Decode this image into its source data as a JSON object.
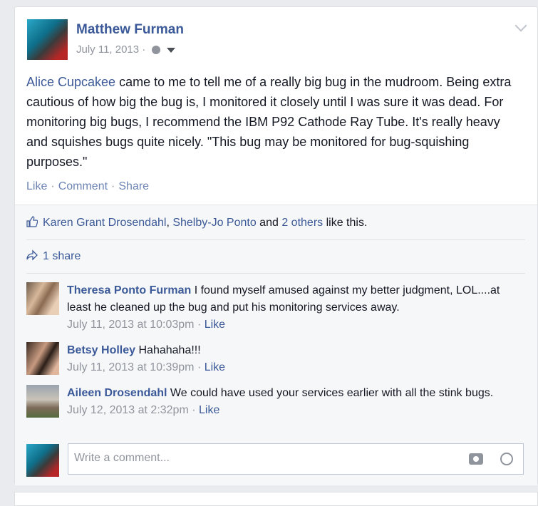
{
  "post": {
    "author": "Matthew Furman",
    "date": "July 11, 2013 ·",
    "text_mention": "Alice Cupcakee",
    "text_rest": " came to me to tell me of a really big bug in the mudroom. Being extra cautious of how big the bug is, I monitored it closely until I was sure it was dead. For monitoring big bugs, I recommend the IBM P92 Cathode Ray Tube. It's really heavy and squishes bugs quite nicely. \"This bug may be monitored for bug-squishing purposes.\"",
    "actions": {
      "like": "Like",
      "comment": "Comment",
      "share": "Share"
    }
  },
  "likes": {
    "user1": "Karen Grant Drosendahl",
    "sep1": ", ",
    "user2": "Shelby-Jo Ponto",
    "and": " and ",
    "others": "2 others",
    "suffix": " like this."
  },
  "shares": {
    "label": "1 share"
  },
  "comments": [
    {
      "name": "Theresa Ponto Furman",
      "text": " I found myself amused against my better judgment, LOL....at least he cleaned up the bug and put his monitoring services away.",
      "time": "July 11, 2013 at 10:03pm",
      "like": "Like"
    },
    {
      "name": "Betsy Holley",
      "text": " Hahahaha!!!",
      "time": "July 11, 2013 at 10:39pm",
      "like": "Like"
    },
    {
      "name": "Aileen Drosendahl",
      "text": " We could have used your services earlier with all the stink bugs.",
      "time": "July 12, 2013 at 2:32pm",
      "like": "Like"
    }
  ],
  "composer": {
    "placeholder": "Write a comment..."
  },
  "icons": {
    "globe": "globe-icon",
    "caret": "caret-down-icon",
    "thumb": "thumbs-up-icon",
    "share": "share-arrow-icon",
    "camera": "camera-icon",
    "smile": "emoji-icon",
    "chevron": "chevron-down-icon"
  },
  "colors": {
    "link": "#3b5998",
    "muted": "#90949c",
    "background": "#e9ebee"
  }
}
